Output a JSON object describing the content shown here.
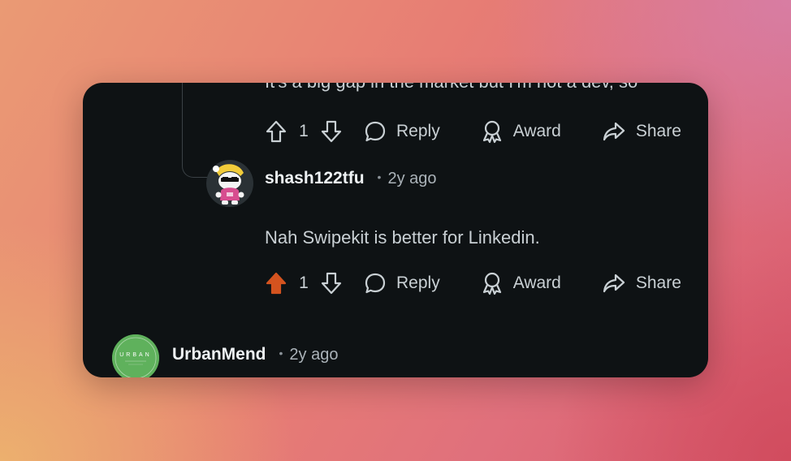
{
  "thread": {
    "prev_comment_text": "It's a big gap in the market but I'm not a dev, so",
    "prev_actions": {
      "vote_count": "1",
      "reply_label": "Reply",
      "award_label": "Award",
      "share_label": "Share"
    },
    "reply": {
      "username": "shash122tfu",
      "dot": "•",
      "time": "2y ago",
      "text": "Nah Swipekit is better for Linkedin.",
      "actions": {
        "vote_count": "1",
        "upvoted": true,
        "reply_label": "Reply",
        "award_label": "Award",
        "share_label": "Share"
      }
    },
    "next_comment": {
      "username": "UrbanMend",
      "dot": "•",
      "time": "2y ago",
      "avatar_text": "URBAN",
      "avatar_color": "#5fb15c"
    }
  },
  "colors": {
    "upvote_active": "#d4531f",
    "text": "#c9d0d4",
    "card_bg": "#0e1214"
  }
}
